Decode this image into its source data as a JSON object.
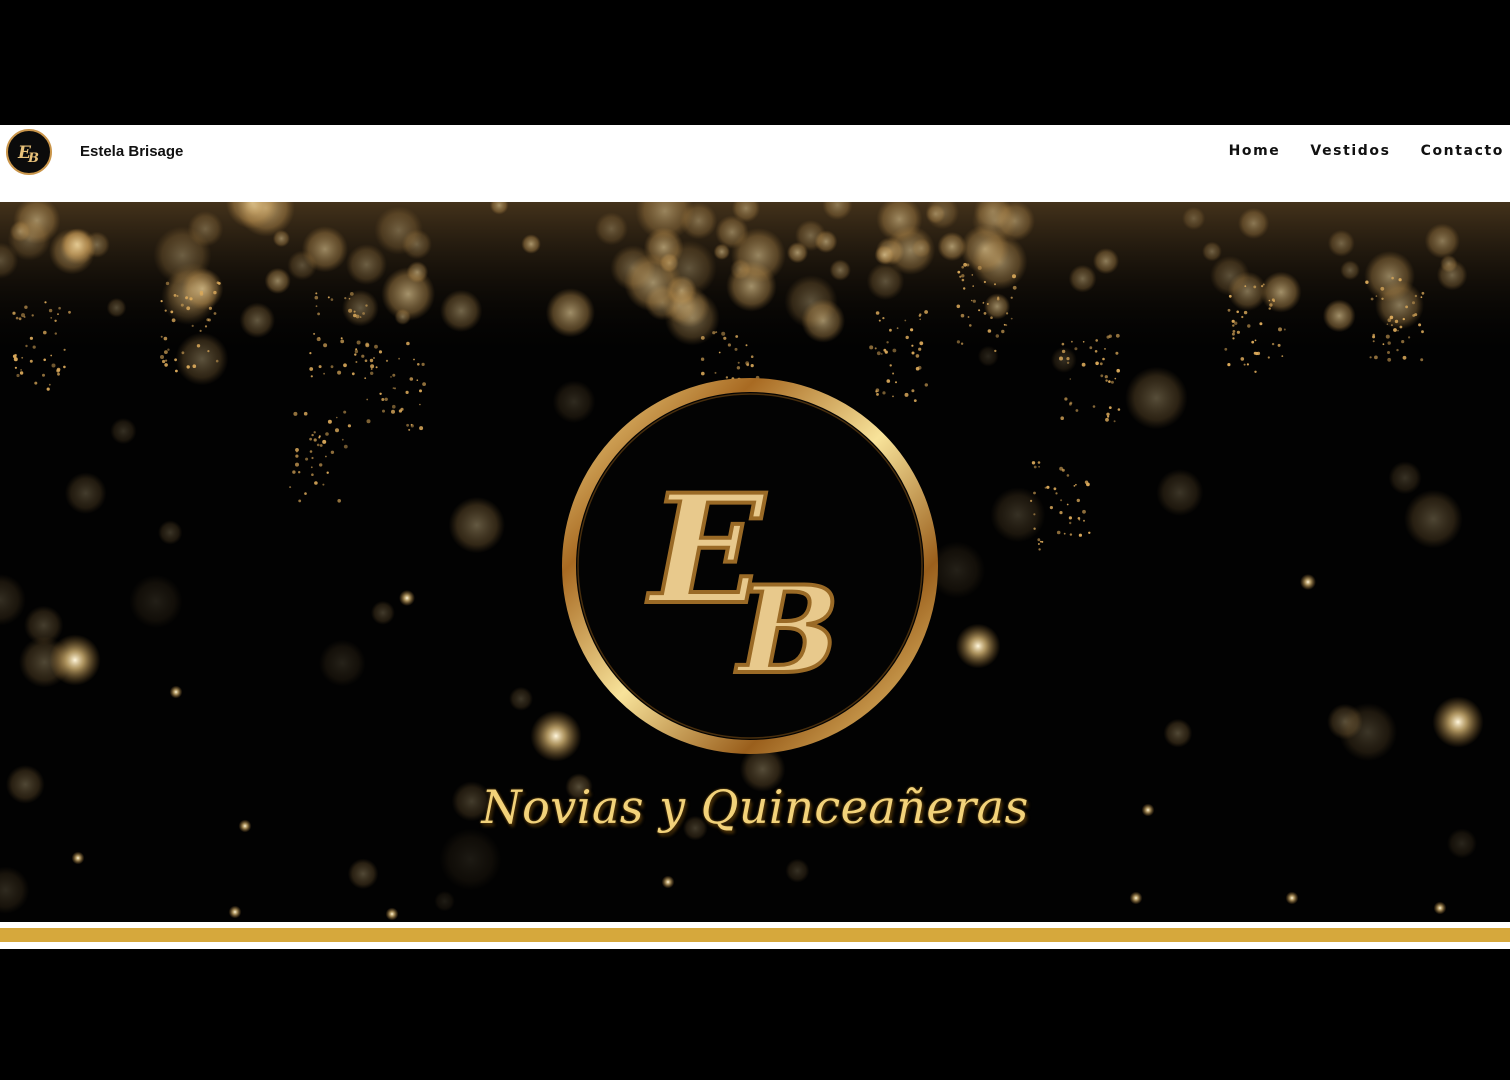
{
  "header": {
    "brand_name": "Estela Brisage",
    "logo_monogram": "EB",
    "nav": [
      {
        "label": "Home"
      },
      {
        "label": "Vestidos"
      },
      {
        "label": "Contacto"
      }
    ]
  },
  "hero": {
    "monogram": "EB",
    "tagline": "Novias y Quinceañeras"
  },
  "colors": {
    "gold": "#d6a83c",
    "gold_light": "#f2d27a",
    "ring_dark": "#8a5a1c",
    "background": "#000000"
  },
  "icons": {
    "logo": "eb-monogram-logo"
  }
}
